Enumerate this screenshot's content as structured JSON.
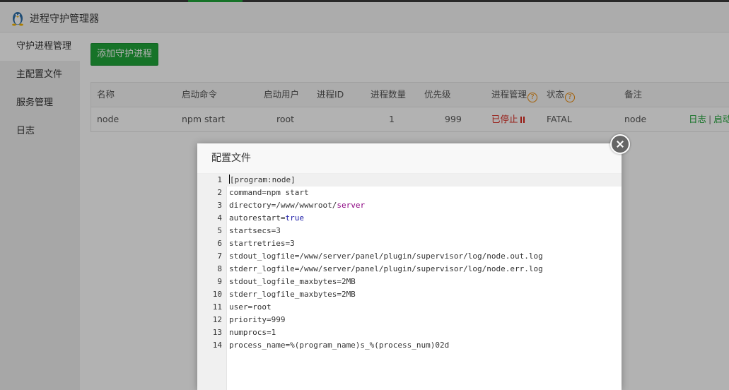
{
  "app": {
    "title": "进程守护管理器",
    "icon": "linux-penguin-icon"
  },
  "sidebar": {
    "items": [
      {
        "label": "守护进程管理"
      },
      {
        "label": "主配置文件"
      },
      {
        "label": "服务管理"
      },
      {
        "label": "日志"
      }
    ]
  },
  "toolbar": {
    "add_label": "添加守护进程"
  },
  "table": {
    "headers": [
      "名称",
      "启动命令",
      "启动用户",
      "进程ID",
      "进程数量",
      "优先级",
      "进程管理",
      "状态",
      "备注"
    ],
    "row": {
      "name": "node",
      "command": "npm start",
      "user": "root",
      "pid": "",
      "numprocs": "1",
      "priority": "999",
      "manage": "已停止",
      "status": "FATAL",
      "note": "node",
      "log_link": "日志",
      "sep": "|",
      "start_link": "启动"
    }
  },
  "modal": {
    "title": "配置文件",
    "lines": [
      {
        "n": "1",
        "text": "[program:node]"
      },
      {
        "n": "2",
        "text": "command=npm start"
      },
      {
        "n": "3",
        "pre": "directory=/www/wwwroot/",
        "val": "server"
      },
      {
        "n": "4",
        "pre": "autorestart=",
        "val": "true"
      },
      {
        "n": "5",
        "text": "startsecs=3"
      },
      {
        "n": "6",
        "text": "startretries=3"
      },
      {
        "n": "7",
        "text": "stdout_logfile=/www/server/panel/plugin/supervisor/log/node.out.log"
      },
      {
        "n": "8",
        "text": "stderr_logfile=/www/server/panel/plugin/supervisor/log/node.err.log"
      },
      {
        "n": "9",
        "text": "stdout_logfile_maxbytes=2MB"
      },
      {
        "n": "10",
        "text": "stderr_logfile_maxbytes=2MB"
      },
      {
        "n": "11",
        "text": "user=root"
      },
      {
        "n": "12",
        "text": "priority=999"
      },
      {
        "n": "13",
        "text": "numprocs=1"
      },
      {
        "n": "14",
        "text": "process_name=%(program_name)s_%(process_num)02d"
      }
    ]
  },
  "colors": {
    "accent": "#20a53a",
    "danger": "#d9261c",
    "hint": "#ea8a0c"
  }
}
